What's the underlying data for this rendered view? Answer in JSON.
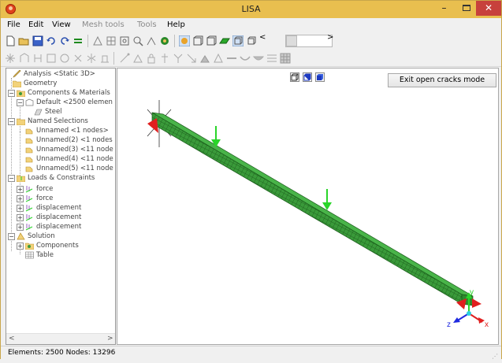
{
  "window": {
    "title": "LISA",
    "minimize_glyph": "–",
    "close_glyph": "✕"
  },
  "menu": {
    "file": "File",
    "edit": "Edit",
    "view": "View",
    "mesh_tools": "Mesh tools",
    "tools": "Tools",
    "help": "Help"
  },
  "toolbar": {
    "scroll_left": "<",
    "scroll_right": ">"
  },
  "tree": {
    "analysis": "Analysis <Static 3D>",
    "geometry": "Geometry",
    "components_materials": "Components & Materials",
    "default_component": "Default <2500 elemen",
    "steel": "Steel",
    "named_selections": "Named Selections",
    "selections": [
      "Unnamed <1 nodes>",
      "Unnamed(2) <1 nodes",
      "Unnamed(3) <11 node",
      "Unnamed(4) <11 node",
      "Unnamed(5) <11 node"
    ],
    "loads_constraints": "Loads & Constraints",
    "loads": [
      "force",
      "force",
      "displacement",
      "displacement",
      "displacement"
    ],
    "solution": "Solution",
    "solution_components": "Components",
    "table": "Table",
    "scroll_left": "<",
    "scroll_right": ">"
  },
  "viewport": {
    "exit_button": "Exit open cracks mode",
    "axes": {
      "x": "x",
      "y": "y",
      "z": "z"
    }
  },
  "status": {
    "text": "Elements: 2500   Nodes: 13296"
  },
  "colors": {
    "titlebar": "#e9bf4f",
    "mesh_fill": "#3a9a3a",
    "mesh_line": "#185818",
    "force_arrow": "#2ad52a",
    "constraint": "#e01f1f",
    "axis_x": "#e01f1f",
    "axis_y": "#2ad52a",
    "axis_z": "#1f2ae0"
  }
}
